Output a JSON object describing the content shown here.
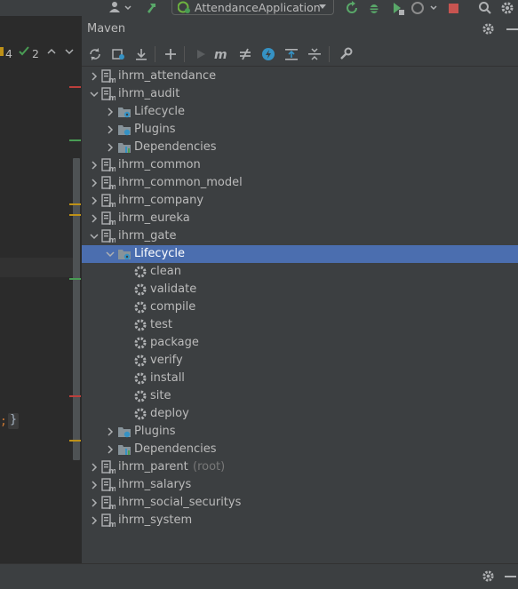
{
  "run_config": {
    "label": "AttendanceApplication"
  },
  "editor": {
    "warnings": "4",
    "checks": "2",
    "code_fragment": ";",
    "brace": "}"
  },
  "maven": {
    "title": "Maven",
    "toolbar": [
      "reload-icon",
      "generate-sources-icon",
      "download-icon",
      "add-icon",
      "run-icon",
      "execute-goal-icon",
      "toggle-offline-icon",
      "skip-tests-icon",
      "show-dependencies-icon",
      "collapse-all-icon",
      "settings-wrench-icon"
    ],
    "tree": [
      {
        "label": "ihrm_attendance",
        "type": "module",
        "depth": 0,
        "arrow": "right"
      },
      {
        "label": "ihrm_audit",
        "type": "module",
        "depth": 0,
        "arrow": "down"
      },
      {
        "label": "Lifecycle",
        "type": "lifecycle",
        "depth": 1,
        "arrow": "right"
      },
      {
        "label": "Plugins",
        "type": "plugins",
        "depth": 1,
        "arrow": "right"
      },
      {
        "label": "Dependencies",
        "type": "deps",
        "depth": 1,
        "arrow": "right"
      },
      {
        "label": "ihrm_common",
        "type": "module",
        "depth": 0,
        "arrow": "right"
      },
      {
        "label": "ihrm_common_model",
        "type": "module",
        "depth": 0,
        "arrow": "right"
      },
      {
        "label": "ihrm_company",
        "type": "module",
        "depth": 0,
        "arrow": "right"
      },
      {
        "label": "ihrm_eureka",
        "type": "module",
        "depth": 0,
        "arrow": "right"
      },
      {
        "label": "ihrm_gate",
        "type": "module",
        "depth": 0,
        "arrow": "down"
      },
      {
        "label": "Lifecycle",
        "type": "lifecycle",
        "depth": 1,
        "arrow": "down",
        "selected": true
      },
      {
        "label": "clean",
        "type": "goal",
        "depth": 2
      },
      {
        "label": "validate",
        "type": "goal",
        "depth": 2
      },
      {
        "label": "compile",
        "type": "goal",
        "depth": 2
      },
      {
        "label": "test",
        "type": "goal",
        "depth": 2
      },
      {
        "label": "package",
        "type": "goal",
        "depth": 2
      },
      {
        "label": "verify",
        "type": "goal",
        "depth": 2
      },
      {
        "label": "install",
        "type": "goal",
        "depth": 2
      },
      {
        "label": "site",
        "type": "goal",
        "depth": 2
      },
      {
        "label": "deploy",
        "type": "goal",
        "depth": 2
      },
      {
        "label": "Plugins",
        "type": "plugins",
        "depth": 1,
        "arrow": "right"
      },
      {
        "label": "Dependencies",
        "type": "deps",
        "depth": 1,
        "arrow": "right"
      },
      {
        "label": "ihrm_parent",
        "type": "module",
        "depth": 0,
        "arrow": "right",
        "tag": "(root)"
      },
      {
        "label": "ihrm_salarys",
        "type": "module",
        "depth": 0,
        "arrow": "right"
      },
      {
        "label": "ihrm_social_securitys",
        "type": "module",
        "depth": 0,
        "arrow": "right"
      },
      {
        "label": "ihrm_system",
        "type": "module",
        "depth": 0,
        "arrow": "right"
      }
    ]
  },
  "colors": {
    "selection": "#4b6eaf",
    "panel_bg": "#3c3f41",
    "editor_bg": "#2b2b2b",
    "text": "#bbbbbb",
    "error_mark": "#bc3f3c",
    "warning_mark": "#be9117",
    "ok_mark": "#499c54"
  }
}
